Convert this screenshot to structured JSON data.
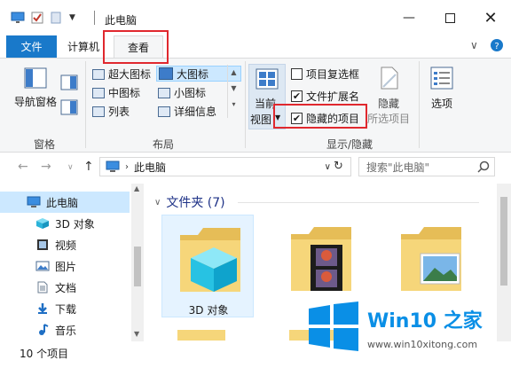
{
  "window": {
    "title": "此电脑"
  },
  "tabs": {
    "file": "文件",
    "computer": "计算机",
    "view": "查看"
  },
  "ribbon": {
    "nav_pane": {
      "label": "导航窗格",
      "group": "窗格"
    },
    "layout": {
      "group": "布局",
      "items": [
        "超大图标",
        "大图标",
        "中图标",
        "小图标",
        "列表",
        "详细信息"
      ],
      "selected": "大图标"
    },
    "current_view": {
      "line1": "当前",
      "line2": "视图"
    },
    "show_hide": {
      "group": "显示/隐藏",
      "item_checkbox": "项目复选框",
      "file_ext": "文件扩展名",
      "hidden_items": "隐藏的项目",
      "hide_selected_line1": "隐藏",
      "hide_selected_line2": "所选项目"
    },
    "options": "选项",
    "checks": {
      "item_checkbox": false,
      "file_ext": true,
      "hidden_items": true
    }
  },
  "address": {
    "path": "此电脑",
    "search_placeholder": "搜索\"此电脑\""
  },
  "sidebar": {
    "items": [
      {
        "label": "此电脑",
        "icon": "pc-icon",
        "selected": true
      },
      {
        "label": "3D 对象",
        "icon": "cube-icon"
      },
      {
        "label": "视频",
        "icon": "video-icon"
      },
      {
        "label": "图片",
        "icon": "picture-icon"
      },
      {
        "label": "文档",
        "icon": "document-icon"
      },
      {
        "label": "下载",
        "icon": "download-icon"
      },
      {
        "label": "音乐",
        "icon": "music-icon"
      }
    ]
  },
  "content": {
    "section_title": "文件夹 (7)",
    "folders": [
      {
        "name": "3D 对象"
      },
      {
        "name": ""
      },
      {
        "name": ""
      }
    ]
  },
  "status": {
    "count": "10 个项目"
  },
  "watermark": {
    "brand": "Win10 之家",
    "url": "www.win10xitong.com"
  },
  "colors": {
    "accent": "#1979ca",
    "selection": "#cce8ff",
    "highlight": "#e0282e"
  }
}
